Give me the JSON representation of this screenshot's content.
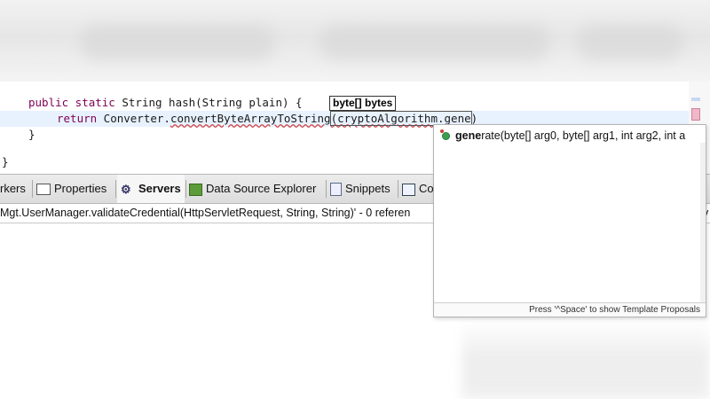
{
  "editor": {
    "line1": {
      "keywords": "public static",
      "rest": " String hash(String plain) {"
    },
    "line2": {
      "keyword": "return",
      "prefix": " Converter.",
      "method": "convertByteArrayToString",
      "arg": "(cryptoAlgorithm.gene",
      "close": ")"
    },
    "line3": "}",
    "line4": "}",
    "param_hint": "byte[] bytes"
  },
  "tabs": [
    {
      "label": "rkers",
      "icon": "markers-icon"
    },
    {
      "label": "Properties",
      "icon": "properties-icon"
    },
    {
      "label": "Servers",
      "icon": "servers-icon",
      "active": true
    },
    {
      "label": "Data Source Explorer",
      "icon": "database-icon"
    },
    {
      "label": "Snippets",
      "icon": "snippets-icon"
    },
    {
      "label": "Co",
      "icon": "console-icon"
    }
  ],
  "status": {
    "text": "Mgt.UserManager.validateCredential(HttpServletRequest, String, String)' - 0 referen",
    "tail": "v"
  },
  "autocomplete": {
    "item_match": "gene",
    "item_rest": "rate(byte[] arg0, byte[] arg1, int arg2, int a",
    "footer": "Press '^Space' to show Template Proposals"
  },
  "colors": {
    "keyword": "#7f0055",
    "current_line": "#e8f2fe",
    "method_icon": "#3aa050"
  }
}
